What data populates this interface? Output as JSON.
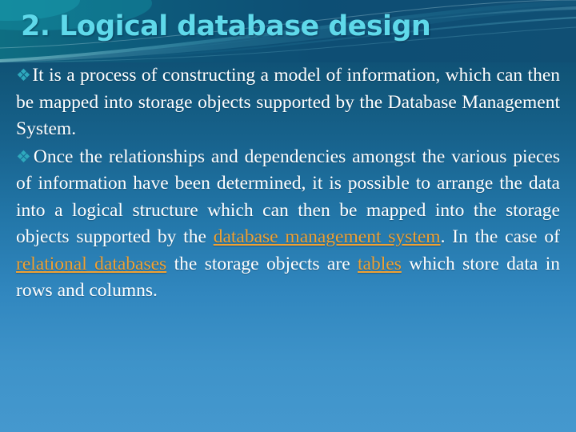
{
  "slide": {
    "title": "2. Logical database design",
    "bullet_glyph": "❖",
    "colors": {
      "title": "#5fd9ea",
      "body_text": "#ffffff",
      "bullet": "#2ea9bd",
      "hyperlink": "#f0a132",
      "bg_top": "#0c4467",
      "bg_bottom": "#4598ce",
      "swoosh": "#3fb9cf"
    },
    "paragraphs": [
      {
        "id": "paragraph-1",
        "runs": [
          {
            "text": "It is a process of constructing a model of information, which can then be mapped into storage objects supported by the Database Management System.",
            "link": false
          }
        ]
      },
      {
        "id": "paragraph-2",
        "runs": [
          {
            "text": "Once the relationships and dependencies amongst the various pieces of information have been determined, it is possible to arrange the data into a logical structure which can then be mapped into the storage objects supported by the ",
            "link": false
          },
          {
            "text": "database management system",
            "link": true
          },
          {
            "text": ". In the case of ",
            "link": false
          },
          {
            "text": "relational databases",
            "link": true
          },
          {
            "text": " the storage objects are ",
            "link": false
          },
          {
            "text": "tables",
            "link": true
          },
          {
            "text": " which store data in rows and columns.",
            "link": false
          }
        ]
      }
    ]
  }
}
